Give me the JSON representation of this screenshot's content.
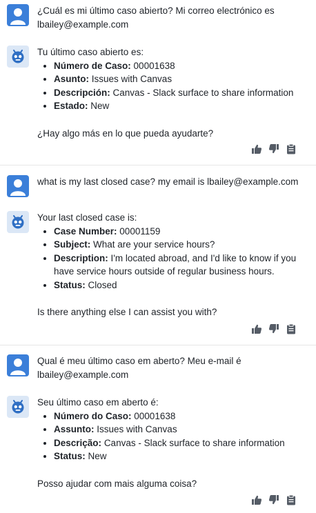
{
  "conversation": [
    {
      "user_text": "¿Cuál es mi último caso abierto? Mi correo electrónico es lbailey@example.com",
      "bot": {
        "intro": "Tu último caso abierto es:",
        "items": [
          {
            "label": "Número de Caso:",
            "value": "00001638"
          },
          {
            "label": "Asunto:",
            "value": "Issues with Canvas"
          },
          {
            "label": "Descripción:",
            "value": "Canvas - Slack surface to share information"
          },
          {
            "label": "Estado:",
            "value": "New"
          }
        ],
        "closing": "¿Hay algo más en lo que pueda ayudarte?"
      }
    },
    {
      "user_text": "what is my last closed case? my email is lbailey@example.com",
      "bot": {
        "intro": "Your last closed case is:",
        "items": [
          {
            "label": "Case Number:",
            "value": "00001159"
          },
          {
            "label": "Subject:",
            "value": "What are your service hours?"
          },
          {
            "label": "Description:",
            "value": "I'm located abroad, and I'd like to know if you have service hours outside of regular business hours."
          },
          {
            "label": "Status:",
            "value": "Closed"
          }
        ],
        "closing": "Is there anything else I can assist you with?"
      }
    },
    {
      "user_text": "Qual é meu último caso em aberto? Meu e-mail é lbailey@example.com",
      "bot": {
        "intro": "Seu último caso em aberto é:",
        "items": [
          {
            "label": "Número do Caso:",
            "value": "00001638"
          },
          {
            "label": "Assunto:",
            "value": "Issues with Canvas"
          },
          {
            "label": "Descrição:",
            "value": "Canvas - Slack surface to share information"
          },
          {
            "label": "Status:",
            "value": "New"
          }
        ],
        "closing": "Posso ajudar com mais alguma coisa?"
      }
    }
  ],
  "icons": {
    "user_avatar": "person-icon",
    "bot_avatar": "robot-icon",
    "thumbs_up": "thumbs-up-icon",
    "thumbs_down": "thumbs-down-icon",
    "copy": "clipboard-icon"
  },
  "colors": {
    "user_avatar_bg": "#3b7fd9",
    "bot_avatar_bg": "#dbe7f6",
    "bot_icon": "#2f6fc4",
    "action_icon": "#555c66"
  }
}
